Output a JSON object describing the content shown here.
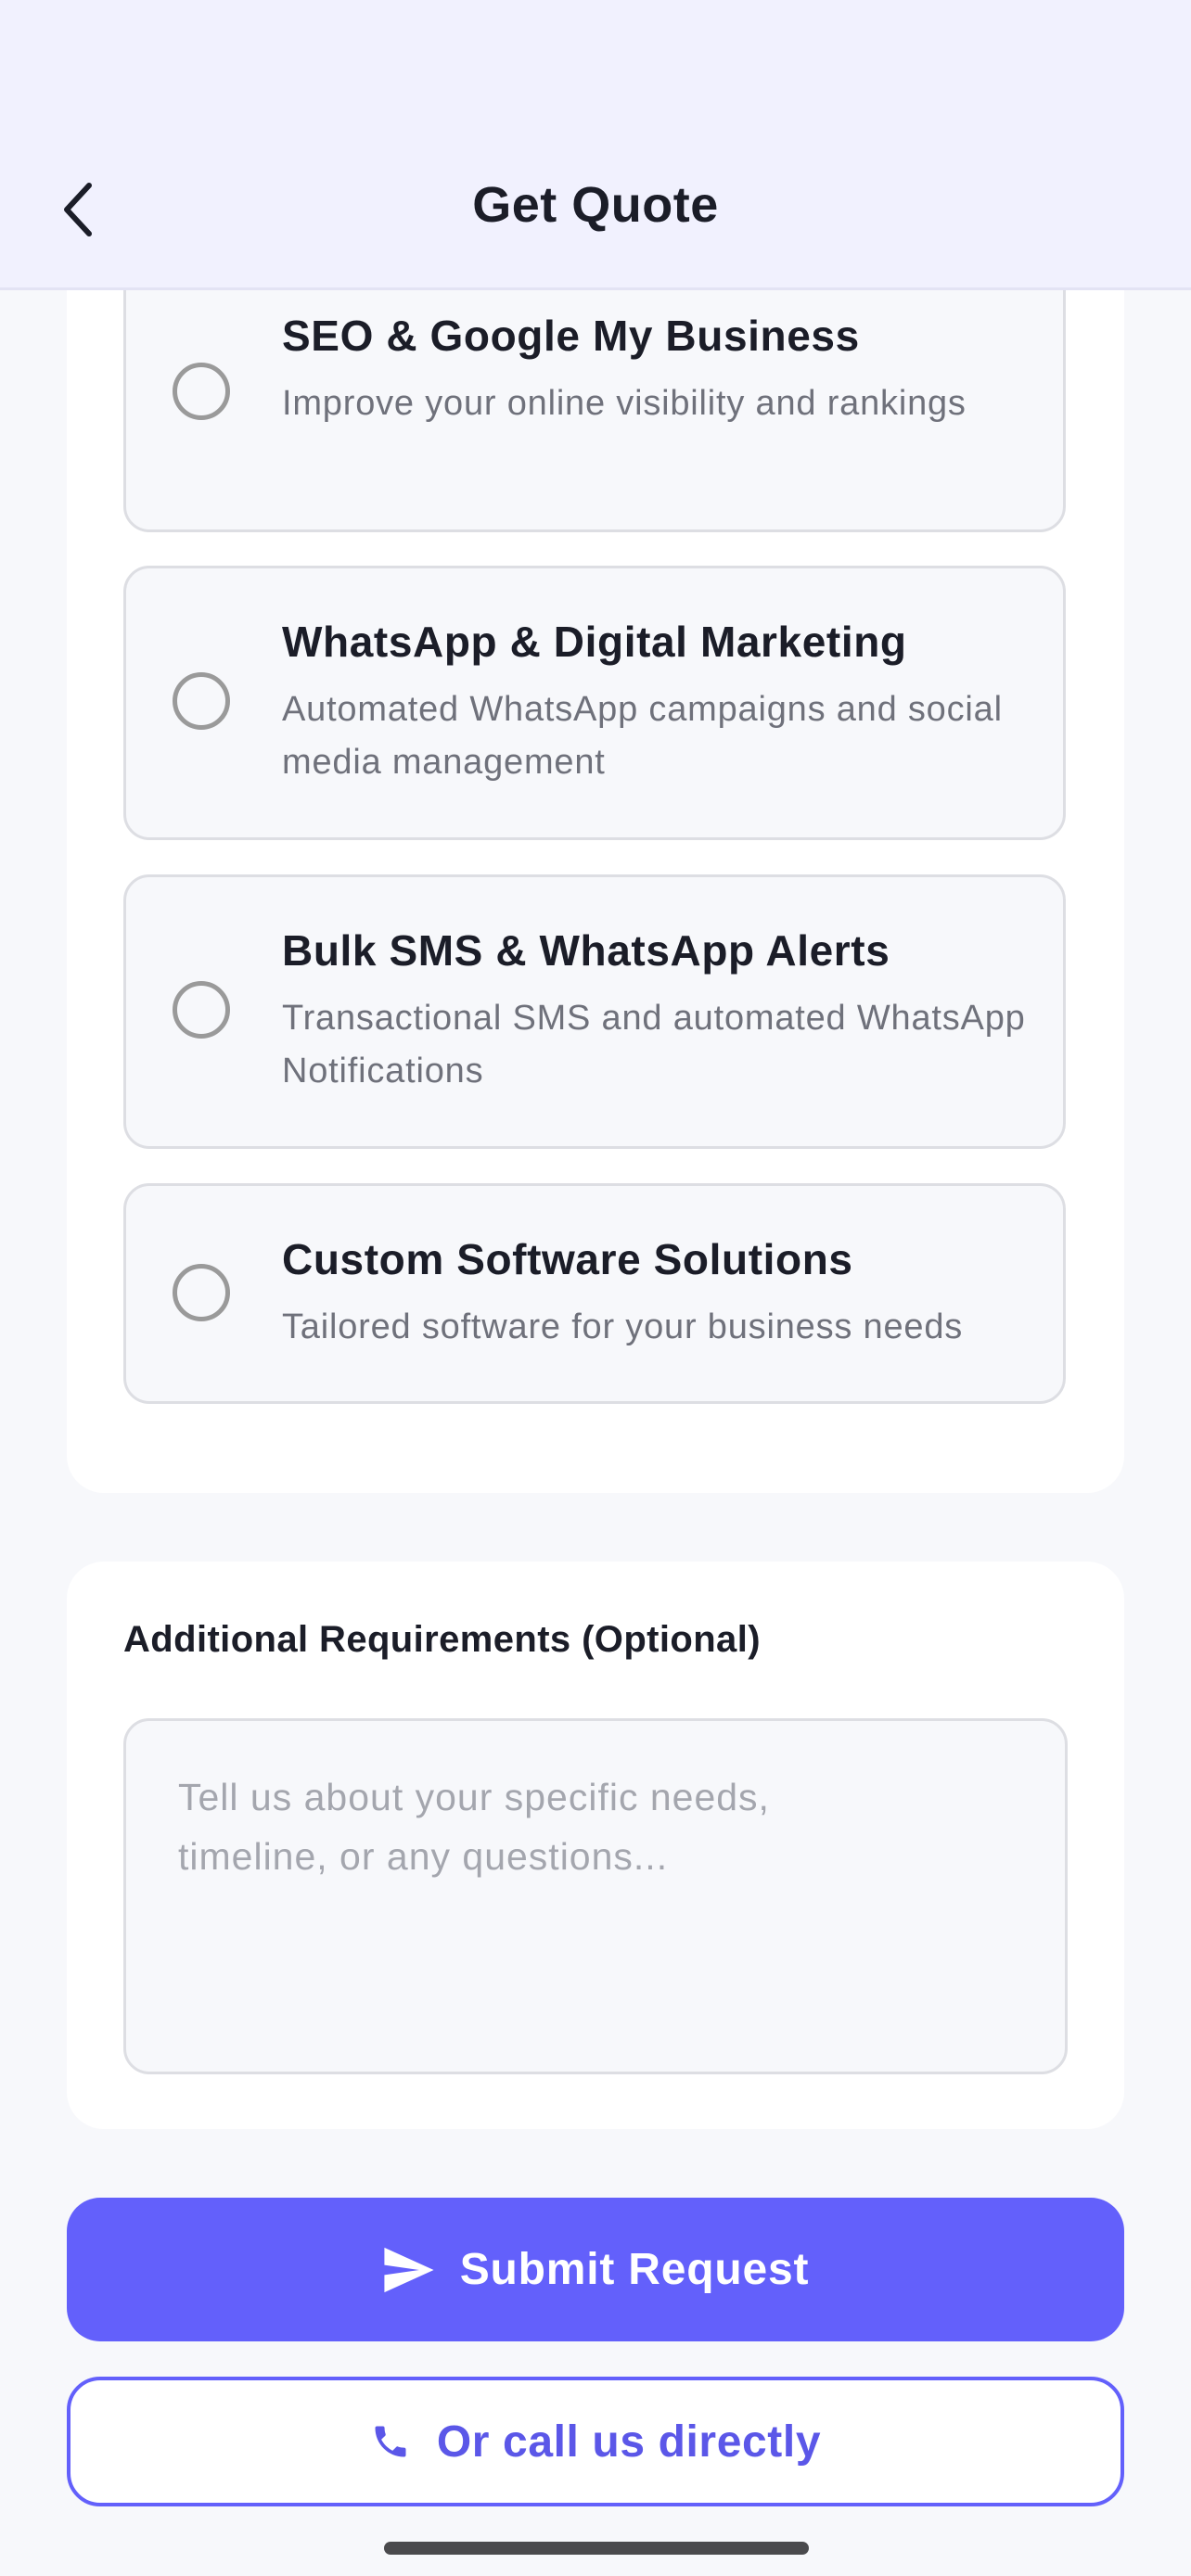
{
  "header": {
    "title": "Get Quote",
    "back_icon": "chevron-left-icon"
  },
  "services": [
    {
      "title": "SEO & Google My Business",
      "description": "Improve your online visibility and rankings",
      "selected": false
    },
    {
      "title": "WhatsApp & Digital Marketing",
      "description": "Automated WhatsApp campaigns and social media management",
      "selected": false
    },
    {
      "title": "Bulk SMS & WhatsApp Alerts",
      "description": "Transactional SMS and automated WhatsApp Notifications",
      "selected": false
    },
    {
      "title": "Custom Software Solutions",
      "description": "Tailored software for your business needs",
      "selected": false
    }
  ],
  "requirements": {
    "label": "Additional Requirements (Optional)",
    "placeholder": "Tell us about your specific needs, timeline, or any questions...",
    "value": ""
  },
  "actions": {
    "submit_label": "Submit Request",
    "submit_icon": "send-icon",
    "call_label": "Or call us directly",
    "call_icon": "phone-icon"
  },
  "colors": {
    "accent": "#6360fb",
    "header_bg": "#f1f1fe",
    "page_bg": "#f7f8fb"
  }
}
